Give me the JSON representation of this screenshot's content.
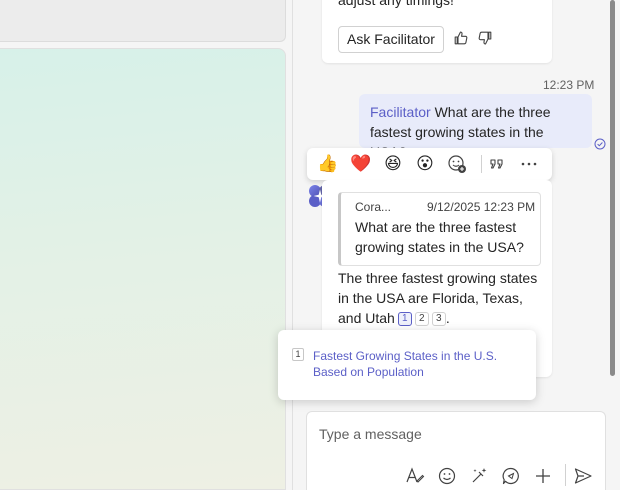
{
  "previous_message": {
    "text": "adjust any timings!",
    "ask_button_label": "Ask Facilitator",
    "icons": [
      "thumbs-up-icon",
      "thumbs-down-icon"
    ]
  },
  "sent_message": {
    "time": "12:23 PM",
    "mention": "Facilitator",
    "text": " What are the three fastest growing states in the USA?",
    "status_icon": "read-receipt-icon"
  },
  "reaction_bar": {
    "reactions": [
      "👍",
      "❤️",
      "😆",
      "😮"
    ],
    "icons": [
      "add-reaction-icon",
      "quote-icon",
      "more-options-icon"
    ]
  },
  "bot_message": {
    "quote": {
      "author": "Cora...",
      "timestamp": "9/12/2025 12:23 PM",
      "text": "What are the three fastest growing states in the USA?"
    },
    "answer": "The three fastest growing states in the USA are Florida, Texas, and Utah",
    "answer_end": ".",
    "citations": [
      "1",
      "2",
      "3"
    ]
  },
  "citation_popup": {
    "number": "1",
    "title": "Fastest Growing States in the U.S. Based on Population"
  },
  "composer": {
    "placeholder": "Type a message",
    "tools": [
      "format-icon",
      "emoji-icon",
      "loop-icon",
      "copilot-chat-icon",
      "attach-icon",
      "send-icon"
    ]
  },
  "colors": {
    "accent": "#5b5fc7",
    "sent_bubble": "#e8ebfa",
    "background": "#f5f5f5"
  }
}
